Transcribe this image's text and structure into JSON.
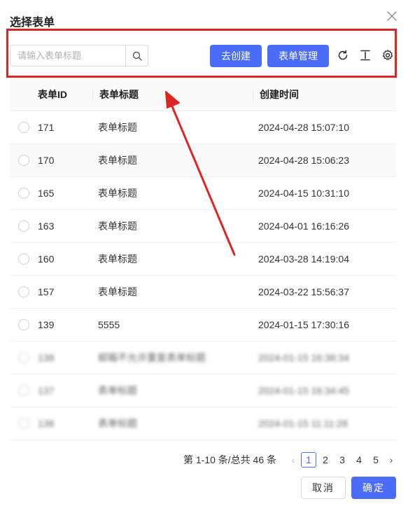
{
  "dialog": {
    "title": "选择表单"
  },
  "toolbar": {
    "search_placeholder": "请输入表单标题",
    "create_label": "去创建",
    "manage_label": "表单管理"
  },
  "table": {
    "headers": {
      "id": "表单ID",
      "title": "表单标题",
      "time": "创建时间"
    },
    "rows": [
      {
        "id": "171",
        "title": "表单标题",
        "time": "2024-04-28 15:07:10"
      },
      {
        "id": "170",
        "title": "表单标题",
        "time": "2024-04-28 15:06:23"
      },
      {
        "id": "165",
        "title": "表单标题",
        "time": "2024-04-15 10:31:10"
      },
      {
        "id": "163",
        "title": "表单标题",
        "time": "2024-04-01 16:16:26"
      },
      {
        "id": "160",
        "title": "表单标题",
        "time": "2024-03-28 14:19:04"
      },
      {
        "id": "157",
        "title": "表单标题",
        "time": "2024-03-22 15:56:37"
      },
      {
        "id": "139",
        "title": "5555",
        "time": "2024-01-15 17:30:16"
      },
      {
        "id": "138",
        "title": "邮箱不允许重复表单标题",
        "time": "2024-01-15 16:38:34"
      },
      {
        "id": "137",
        "title": "表单标题",
        "time": "2024-01-15 16:34:45"
      },
      {
        "id": "136",
        "title": "表单标题",
        "time": "2024-01-15 11:11:28"
      }
    ]
  },
  "pagination": {
    "total_text": "第 1-10 条/总共 46 条",
    "pages": [
      "1",
      "2",
      "3",
      "4",
      "5"
    ],
    "current": "1"
  },
  "footer": {
    "cancel_label": "取消",
    "ok_label": "确定"
  },
  "colors": {
    "primary": "#4a6cf7",
    "highlight": "#e02424"
  }
}
